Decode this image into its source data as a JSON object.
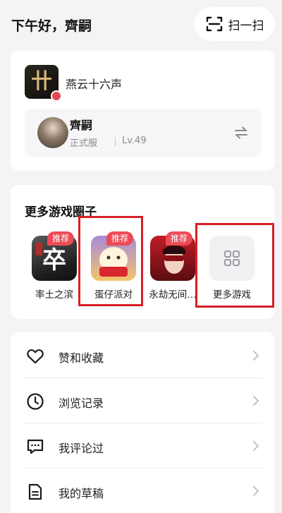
{
  "header": {
    "greeting": "下午好，齊嗣",
    "scan_label": "扫一扫"
  },
  "game": {
    "name": "燕云十六声",
    "role": {
      "name": "齊嗣",
      "server": "正式服",
      "level": "Lv.49"
    }
  },
  "circles": {
    "title": "更多游戏圈子",
    "items": [
      {
        "label": "率土之滨",
        "tag": "推荐"
      },
      {
        "label": "蛋仔派对",
        "tag": "推荐"
      },
      {
        "label": "永劫无间…",
        "tag": "推荐"
      },
      {
        "label": "更多游戏"
      }
    ]
  },
  "menu": [
    {
      "label": "赞和收藏",
      "icon": "heart-icon"
    },
    {
      "label": "浏览记录",
      "icon": "clock-icon"
    },
    {
      "label": "我评论过",
      "icon": "comment-icon"
    },
    {
      "label": "我的草稿",
      "icon": "draft-icon"
    }
  ],
  "colors": {
    "background": "#f4f4f6",
    "tag_red": "#ec4b55",
    "highlight_red": "#d61f26"
  }
}
